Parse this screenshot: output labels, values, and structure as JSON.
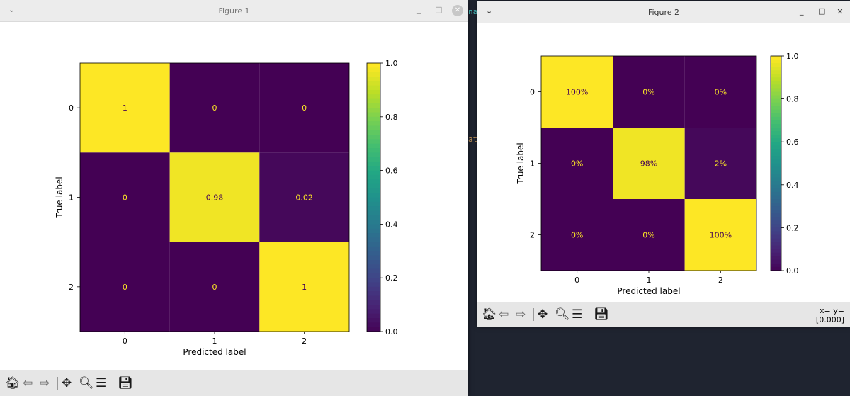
{
  "background": {
    "fragment_a": "na",
    "fragment_b": "at"
  },
  "figure1": {
    "title": "Figure 1",
    "minimize": "_",
    "maximize": "□",
    "close": "✕",
    "ylabel": "True label",
    "xlabel": "Predicted label",
    "tick_labels": [
      "0",
      "1",
      "2"
    ],
    "cell_labels": [
      [
        "1",
        "0",
        "0"
      ],
      [
        "0",
        "0.98",
        "0.02"
      ],
      [
        "0",
        "0",
        "1"
      ]
    ],
    "colorbar_ticks": [
      "0.0",
      "0.2",
      "0.4",
      "0.6",
      "0.8",
      "1.0"
    ]
  },
  "figure2": {
    "title": "Figure 2",
    "minimize": "_",
    "maximize": "□",
    "close": "✕",
    "ylabel": "True label",
    "xlabel": "Predicted label",
    "tick_labels": [
      "0",
      "1",
      "2"
    ],
    "cell_labels": [
      [
        "100%",
        "0%",
        "0%"
      ],
      [
        "0%",
        "98%",
        "2%"
      ],
      [
        "0%",
        "0%",
        "100%"
      ]
    ],
    "colorbar_ticks": [
      "0.0",
      "0.2",
      "0.4",
      "0.6",
      "0.8",
      "1.0"
    ],
    "coord_line1": "x= y=",
    "coord_line2": "[0.000]"
  },
  "toolbar_icons": [
    "home-icon",
    "back-icon",
    "forward-icon",
    "pan-icon",
    "zoom-icon",
    "configure-icon",
    "save-icon"
  ],
  "chart_data": [
    {
      "type": "heatmap",
      "title": "",
      "xlabel": "Predicted label",
      "ylabel": "True label",
      "x_categories": [
        "0",
        "1",
        "2"
      ],
      "y_categories": [
        "0",
        "1",
        "2"
      ],
      "values": [
        [
          1,
          0,
          0
        ],
        [
          0,
          0.98,
          0.02
        ],
        [
          0,
          0,
          1
        ]
      ],
      "colormap": "viridis",
      "colorbar_range": [
        0,
        1
      ],
      "colorbar_ticks": [
        0.0,
        0.2,
        0.4,
        0.6,
        0.8,
        1.0
      ]
    },
    {
      "type": "heatmap",
      "title": "",
      "xlabel": "Predicted label",
      "ylabel": "True label",
      "x_categories": [
        "0",
        "1",
        "2"
      ],
      "y_categories": [
        "0",
        "1",
        "2"
      ],
      "values": [
        [
          1,
          0,
          0
        ],
        [
          0,
          0.98,
          0.02
        ],
        [
          0,
          0,
          1
        ]
      ],
      "value_format": "percent",
      "colormap": "viridis",
      "colorbar_range": [
        0,
        1
      ],
      "colorbar_ticks": [
        0.0,
        0.2,
        0.4,
        0.6,
        0.8,
        1.0
      ]
    }
  ],
  "colors": {
    "viridis_low": "#440154",
    "viridis_high": "#fde725",
    "text_on_dark": "#fde725",
    "text_on_light": "#440154"
  }
}
